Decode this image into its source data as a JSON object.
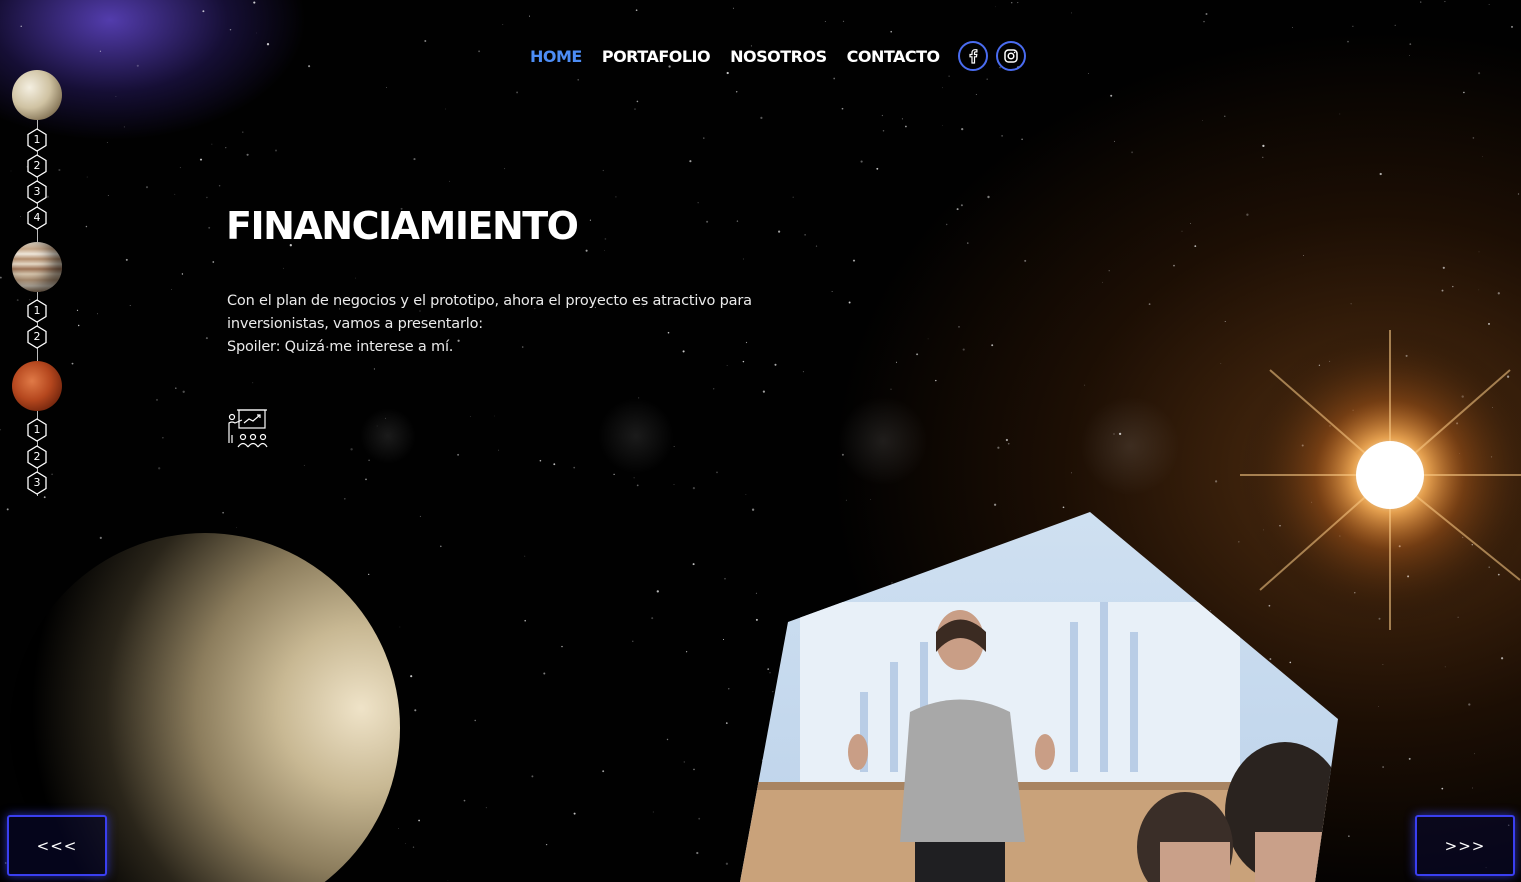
{
  "nav": {
    "items": [
      {
        "label": "HOME",
        "active": true
      },
      {
        "label": "PORTAFOLIO",
        "active": false
      },
      {
        "label": "NOSOTROS",
        "active": false
      },
      {
        "label": "CONTACTO",
        "active": false
      }
    ],
    "active_color": "#4d8df5",
    "social": [
      {
        "icon": "facebook-icon"
      },
      {
        "icon": "instagram-icon"
      }
    ]
  },
  "rail": {
    "groups": [
      {
        "planet": "moon-planet",
        "steps": [
          "1",
          "2",
          "3",
          "4"
        ]
      },
      {
        "planet": "jupiter-planet",
        "steps": [
          "1",
          "2"
        ]
      },
      {
        "planet": "mars-planet",
        "steps": [
          "1",
          "2",
          "3"
        ]
      }
    ]
  },
  "content": {
    "title": "FINANCIAMIENTO",
    "description_lines": [
      "Con el plan de negocios y el prototipo, ahora el proyecto es atractivo para",
      "inversionistas, vamos a presentarlo:",
      "Spoiler: Quizá me interese a mí."
    ],
    "icon": "presentation-icon"
  },
  "controls": {
    "prev_label": "<<<",
    "next_label": ">>>"
  },
  "colors": {
    "accent": "#4a6cf0",
    "arrow_border": "#3a3ff0"
  }
}
